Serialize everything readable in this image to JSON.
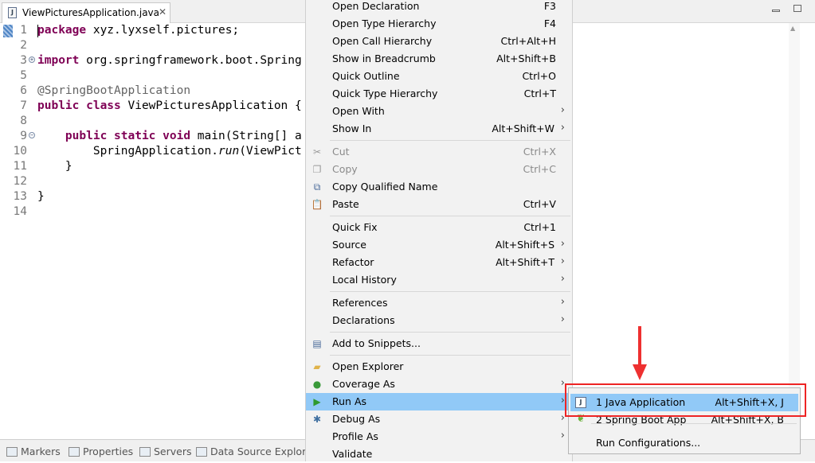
{
  "editor_tab": {
    "title": "ViewPicturesApplication.java",
    "close": "✕"
  },
  "code_lines": [
    {
      "n": "1",
      "html": "<span class=\"kw\">package</span> xyz.lyxself.pictures;"
    },
    {
      "n": "2",
      "html": ""
    },
    {
      "n": "3",
      "html": "<span class=\"kw\">import</span> org.springframework.boot.Spring"
    },
    {
      "n": "5",
      "html": ""
    },
    {
      "n": "6",
      "html": "<span class=\"ann\">@SpringBootApplication</span>"
    },
    {
      "n": "7",
      "html": "<span class=\"kw\">public class</span> ViewPicturesApplication {"
    },
    {
      "n": "8",
      "html": ""
    },
    {
      "n": "9",
      "html": "    <span class=\"kw\">public static void</span> main(String[] a"
    },
    {
      "n": "10",
      "html": "        SpringApplication.<span class=\"it\">run</span>(ViewPict"
    },
    {
      "n": "11",
      "html": "    }"
    },
    {
      "n": "12",
      "html": ""
    },
    {
      "n": "13",
      "html": "}"
    },
    {
      "n": "14",
      "html": ""
    }
  ],
  "context_menu": [
    {
      "label": "Open Declaration",
      "shortcut": "F3"
    },
    {
      "label": "Open Type Hierarchy",
      "shortcut": "F4"
    },
    {
      "label": "Open Call Hierarchy",
      "shortcut": "Ctrl+Alt+H"
    },
    {
      "label": "Show in Breadcrumb",
      "shortcut": "Alt+Shift+B"
    },
    {
      "label": "Quick Outline",
      "shortcut": "Ctrl+O"
    },
    {
      "label": "Quick Type Hierarchy",
      "shortcut": "Ctrl+T"
    },
    {
      "label": "Open With",
      "shortcut": "",
      "submenu": true
    },
    {
      "label": "Show In",
      "shortcut": "Alt+Shift+W",
      "submenu": true
    },
    {
      "separator": true
    },
    {
      "label": "Cut",
      "shortcut": "Ctrl+X",
      "disabled": true,
      "icon": "scissors-icon"
    },
    {
      "label": "Copy",
      "shortcut": "Ctrl+C",
      "disabled": true,
      "icon": "copy-icon"
    },
    {
      "label": "Copy Qualified Name",
      "shortcut": "",
      "icon": "copy-qualified-icon"
    },
    {
      "label": "Paste",
      "shortcut": "Ctrl+V",
      "icon": "paste-icon"
    },
    {
      "separator": true
    },
    {
      "label": "Quick Fix",
      "shortcut": "Ctrl+1"
    },
    {
      "label": "Source",
      "shortcut": "Alt+Shift+S",
      "submenu": true
    },
    {
      "label": "Refactor",
      "shortcut": "Alt+Shift+T",
      "submenu": true
    },
    {
      "label": "Local History",
      "shortcut": "",
      "submenu": true
    },
    {
      "separator": true
    },
    {
      "label": "References",
      "shortcut": "",
      "submenu": true
    },
    {
      "label": "Declarations",
      "shortcut": "",
      "submenu": true
    },
    {
      "separator": true
    },
    {
      "label": "Add to Snippets...",
      "shortcut": "",
      "icon": "snippets-icon"
    },
    {
      "separator": true
    },
    {
      "label": "Open Explorer",
      "shortcut": "",
      "icon": "folder-icon"
    },
    {
      "label": "Coverage As",
      "shortcut": "",
      "submenu": true,
      "icon": "coverage-icon"
    },
    {
      "label": "Run As",
      "shortcut": "",
      "submenu": true,
      "highlighted": true,
      "icon": "run-icon"
    },
    {
      "label": "Debug As",
      "shortcut": "",
      "submenu": true,
      "icon": "debug-icon"
    },
    {
      "label": "Profile As",
      "shortcut": "",
      "submenu": true
    },
    {
      "label": "Validate",
      "shortcut": ""
    }
  ],
  "run_as_submenu": [
    {
      "label": "1 Java Application",
      "shortcut": "Alt+Shift+X, J",
      "highlighted": true,
      "icon": "java-app-icon"
    },
    {
      "label": "2 Spring Boot App",
      "shortcut": "Alt+Shift+X, B",
      "icon": "spring-icon"
    },
    {
      "label": "Run Configurations...",
      "shortcut": ""
    }
  ],
  "bottom_tabs": [
    "Markers",
    "Properties",
    "Servers",
    "Data Source Explore"
  ],
  "colors": {
    "highlight": "#91c9f7",
    "annotation_red": "#ee2424",
    "keyword": "#7f0055"
  }
}
